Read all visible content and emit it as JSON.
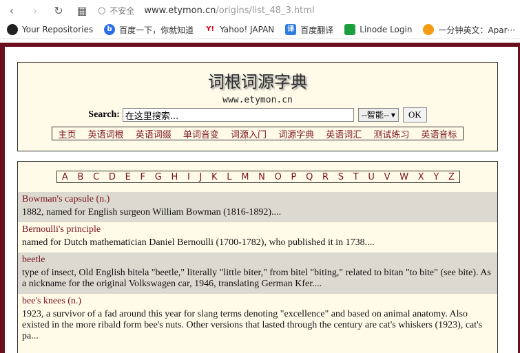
{
  "browser": {
    "insecure_label": "不安全",
    "url_host": "www.etymon.cn",
    "url_path": "/origins/list_48_3.html"
  },
  "bookmarks": [
    {
      "label": "Your Repositories",
      "icon": "github-icon"
    },
    {
      "label": "百度一下，你就知道",
      "icon": "baidu-icon"
    },
    {
      "label": "Yahoo! JAPAN",
      "icon": "yahoo-icon"
    },
    {
      "label": "百度翻译",
      "icon": "translate-icon"
    },
    {
      "label": "Linode Login",
      "icon": "linode-icon"
    },
    {
      "label": "一分钟英文：Apar···",
      "icon": "orange-icon"
    }
  ],
  "site": {
    "title": "词根词源字典",
    "url": "www.etymon.cn",
    "search_label": "Search:",
    "search_value": "在这里搜索...",
    "select_value": "--智能--",
    "ok_label": "OK",
    "menu": [
      "主页",
      "英语词根",
      "英语词缀",
      "单词音变",
      "词源入门",
      "词源字典",
      "英语词汇",
      "测试练习",
      "英语音标"
    ]
  },
  "alphabet": [
    "A",
    "B",
    "C",
    "D",
    "E",
    "F",
    "G",
    "H",
    "I",
    "J",
    "K",
    "L",
    "M",
    "N",
    "O",
    "P",
    "Q",
    "R",
    "S",
    "T",
    "U",
    "V",
    "W",
    "X",
    "Y",
    "Z"
  ],
  "entries": [
    {
      "term": "Bowman's capsule (n.)",
      "def": "1882, named for English surgeon William Bowman (1816-1892)...."
    },
    {
      "term": "Bernoulli's principle",
      "def": "named for Dutch mathematician Daniel Bernoulli (1700-1782), who published it in 1738...."
    },
    {
      "term": "beetle",
      "def": "type of insect, Old English bitela \"beetle,\" literally \"little biter,\" from bitel \"biting,\" related to bitan \"to bite\" (see bite). As a nickname for the original Volkswagen car, 1946, translating German Kfer...."
    },
    {
      "term": "bee's knees (n.)",
      "def": "1923, a survivor of a fad around this year for slang terms denoting \"excellence\" and based on animal anatomy. Also existed in the more ribald form bee's nuts. Other versions that lasted through the century are cat's whiskers (1923), cat's pa..."
    }
  ]
}
